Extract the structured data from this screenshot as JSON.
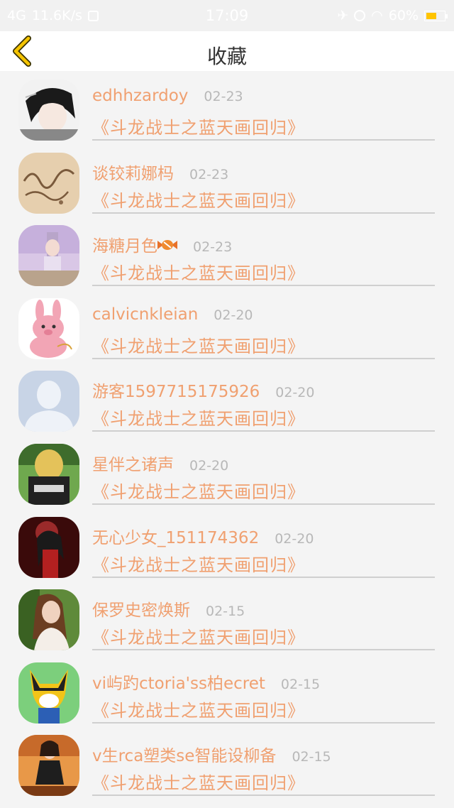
{
  "status_bar": {
    "network": "4G",
    "speed": "11.6K/s",
    "time": "17:09",
    "battery": "60%",
    "battery_level": 0.6,
    "battery_color": "#ffc400"
  },
  "nav": {
    "title": "收藏",
    "back_icon": "chevron-left-icon",
    "back_color": "#f5c400"
  },
  "colors": {
    "accent": "#f0a070",
    "date": "#b8b8b8",
    "divider": "#cfcfcf",
    "background": "#f4f4f4"
  },
  "items": [
    {
      "username": "edhhzardoy",
      "date": "02-23",
      "title": "《斗龙战士之蓝天画回归》",
      "avatar": "anime-boy-avatar"
    },
    {
      "username": "谈铰莉娜杩",
      "date": "02-23",
      "title": "《斗龙战士之蓝天画回归》",
      "avatar": "sand-writing-avatar"
    },
    {
      "username": "海糖月色",
      "date": "02-23",
      "title": "《斗龙战士之蓝天画回归》",
      "avatar": "pastel-girl-avatar",
      "suffix_icon": "candy-icon"
    },
    {
      "username": "calvicnkleian",
      "date": "02-20",
      "title": "《斗龙战士之蓝天画回归》",
      "avatar": "pink-bunny-avatar"
    },
    {
      "username": "游客1597715175926",
      "date": "02-20",
      "title": "《斗龙战士之蓝天画回归》",
      "avatar": "default-user-avatar"
    },
    {
      "username": "星伴之诸声",
      "date": "02-20",
      "title": "《斗龙战士之蓝天画回归》",
      "avatar": "fashion-tour-avatar"
    },
    {
      "username": "无心少女_151174362",
      "date": "02-20",
      "title": "《斗龙战士之蓝天画回归》",
      "avatar": "dark-warrior-avatar"
    },
    {
      "username": "保罗史密焕斯",
      "date": "02-15",
      "title": "《斗龙战士之蓝天画回归》",
      "avatar": "woman-portrait-avatar"
    },
    {
      "username": "vi屿趵ctoria'ss柏ecret",
      "date": "02-15",
      "title": "《斗龙战士之蓝天画回归》",
      "avatar": "wolverine-cartoon-avatar"
    },
    {
      "username": "v生rca塑类se智能设柳备",
      "date": "02-15",
      "title": "《斗龙战士之蓝天画回归》",
      "avatar": "autumn-girl-avatar"
    }
  ]
}
